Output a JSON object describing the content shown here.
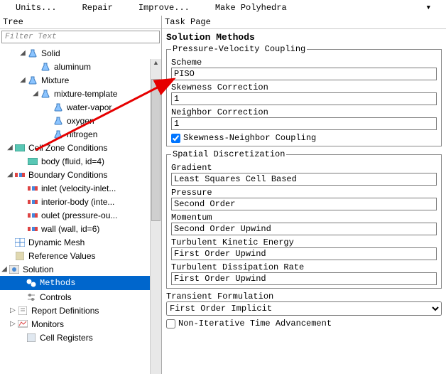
{
  "menu": {
    "units": "Units...",
    "repair": "Repair",
    "improve": "Improve...",
    "poly": "Make Polyhedra"
  },
  "panes": {
    "tree": "Tree",
    "task": "Task Page"
  },
  "filter": "Filter Text",
  "tree": {
    "solid": "Solid",
    "aluminum": "aluminum",
    "mixture": "Mixture",
    "mixtmpl": "mixture-template",
    "wvap": "water-vapor",
    "oxy": "oxygen",
    "nit": "nitrogen",
    "czc": "Cell Zone Conditions",
    "body": "body (fluid, id=4)",
    "bc": "Boundary Conditions",
    "inlet": "inlet (velocity-inlet...",
    "intb": "interior-body (inte...",
    "outlet": "oulet (pressure-ou...",
    "wall": "wall (wall, id=6)",
    "dynm": "Dynamic Mesh",
    "refv": "Reference Values",
    "sol": "Solution",
    "methods": "Methods",
    "controls": "Controls",
    "rdef": "Report Definitions",
    "mon": "Monitors",
    "creg": "Cell Registers"
  },
  "task": {
    "title": "Solution Methods",
    "grp_pv": "Pressure-Velocity Coupling",
    "scheme_l": "Scheme",
    "scheme_v": "PISO",
    "skew_l": "Skewness Correction",
    "skew_v": "1",
    "neigh_l": "Neighbor Correction",
    "neigh_v": "1",
    "sncoup": "Skewness-Neighbor Coupling",
    "grp_sd": "Spatial Discretization",
    "grad_l": "Gradient",
    "grad_v": "Least Squares Cell Based",
    "press_l": "Pressure",
    "press_v": "Second Order",
    "mom_l": "Momentum",
    "mom_v": "Second Order Upwind",
    "tke_l": "Turbulent Kinetic Energy",
    "tke_v": "First Order Upwind",
    "tdr_l": "Turbulent Dissipation Rate",
    "tdr_v": "First Order Upwind",
    "tf_l": "Transient Formulation",
    "tf_v": "First Order Implicit",
    "nita": "Non-Iterative Time Advancement"
  }
}
